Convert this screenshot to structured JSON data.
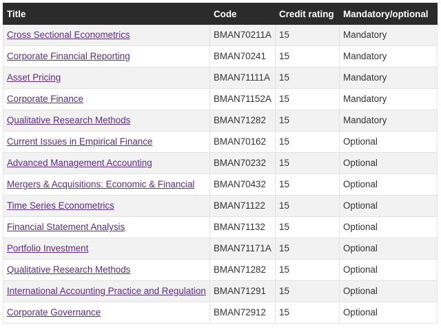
{
  "table": {
    "headers": {
      "title": "Title",
      "code": "Code",
      "credit": "Credit rating",
      "mandatory": "Mandatory/optional"
    },
    "rows": [
      {
        "title": "Cross Sectional Econometrics",
        "code": "BMAN70211A",
        "credit": "15",
        "status": "Mandatory"
      },
      {
        "title": "Corporate Financial Reporting",
        "code": "BMAN70241",
        "credit": "15",
        "status": "Mandatory"
      },
      {
        "title": "Asset Pricing",
        "code": "BMAN71111A",
        "credit": "15",
        "status": "Mandatory"
      },
      {
        "title": "Corporate Finance",
        "code": "BMAN71152A",
        "credit": "15",
        "status": "Mandatory"
      },
      {
        "title": "Qualitative Research Methods",
        "code": "BMAN71282",
        "credit": "15",
        "status": "Mandatory"
      },
      {
        "title": "Current Issues in Empirical Finance",
        "code": "BMAN70162",
        "credit": "15",
        "status": "Optional"
      },
      {
        "title": "Advanced Management Accounting",
        "code": "BMAN70232",
        "credit": "15",
        "status": "Optional"
      },
      {
        "title": "Mergers & Acquisitions: Economic & Financial",
        "code": "BMAN70432",
        "credit": "15",
        "status": "Optional"
      },
      {
        "title": "Time Series Econometrics",
        "code": "BMAN71122",
        "credit": "15",
        "status": "Optional"
      },
      {
        "title": "Financial Statement Analysis",
        "code": "BMAN71132",
        "credit": "15",
        "status": "Optional"
      },
      {
        "title": "Portfolio Investment",
        "code": "BMAN71171A",
        "credit": "15",
        "status": "Optional"
      },
      {
        "title": "Qualitative Research Methods",
        "code": "BMAN71282",
        "credit": "15",
        "status": "Optional"
      },
      {
        "title": "International Accounting Practice and Regulation",
        "code": "BMAN71291",
        "credit": "15",
        "status": "Optional"
      },
      {
        "title": "Corporate Governance",
        "code": "BMAN72912",
        "credit": "15",
        "status": "Optional"
      }
    ]
  },
  "colors": {
    "header_bg": "#2b2b2b",
    "header_text": "#ffffff",
    "link": "#5b2a86",
    "row_alt": "#f2f2f2",
    "border": "#e3e3e3"
  }
}
